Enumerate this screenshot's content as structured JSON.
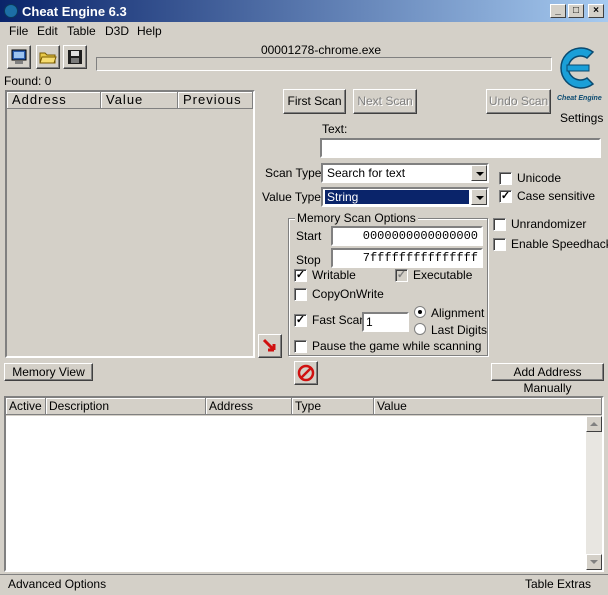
{
  "window": {
    "title": "Cheat Engine 6.3"
  },
  "menu": [
    "File",
    "Edit",
    "Table",
    "D3D",
    "Help"
  ],
  "process": {
    "name": "00001278-chrome.exe"
  },
  "found": "Found: 0",
  "settings_label": "Settings",
  "logo_caption": "Cheat Engine",
  "results_columns": [
    "Address",
    "Value",
    "Previous"
  ],
  "buttons": {
    "first_scan": "First Scan",
    "next_scan": "Next Scan",
    "undo_scan": "Undo Scan",
    "memory_view": "Memory View",
    "add_address": "Add Address Manually"
  },
  "scan": {
    "text_label": "Text:",
    "text_value": "",
    "scan_type_label": "Scan Type",
    "scan_type_value": "Search for text",
    "value_type_label": "Value Type",
    "value_type_value": "String"
  },
  "options": {
    "unicode": "Unicode",
    "case_sensitive": "Case sensitive",
    "unrandomizer": "Unrandomizer",
    "speedhack": "Enable Speedhack"
  },
  "memory_scan": {
    "title": "Memory Scan Options",
    "start_label": "Start",
    "start_value": "0000000000000000",
    "stop_label": "Stop",
    "stop_value": "7fffffffffffffff",
    "writable": "Writable",
    "executable": "Executable",
    "copyonwrite": "CopyOnWrite",
    "fast_scan": "Fast Scan",
    "fast_scan_value": "1",
    "alignment": "Alignment",
    "last_digits": "Last Digits",
    "pause": "Pause the game while scanning"
  },
  "table_columns": [
    "Active",
    "Description",
    "Address",
    "Type",
    "Value"
  ],
  "status": {
    "left": "Advanced Options",
    "right": "Table Extras"
  },
  "colors": {
    "title_start": "#0a246a",
    "title_end": "#a6caf0",
    "selection": "#0a246a",
    "face": "#d4d0c8"
  }
}
